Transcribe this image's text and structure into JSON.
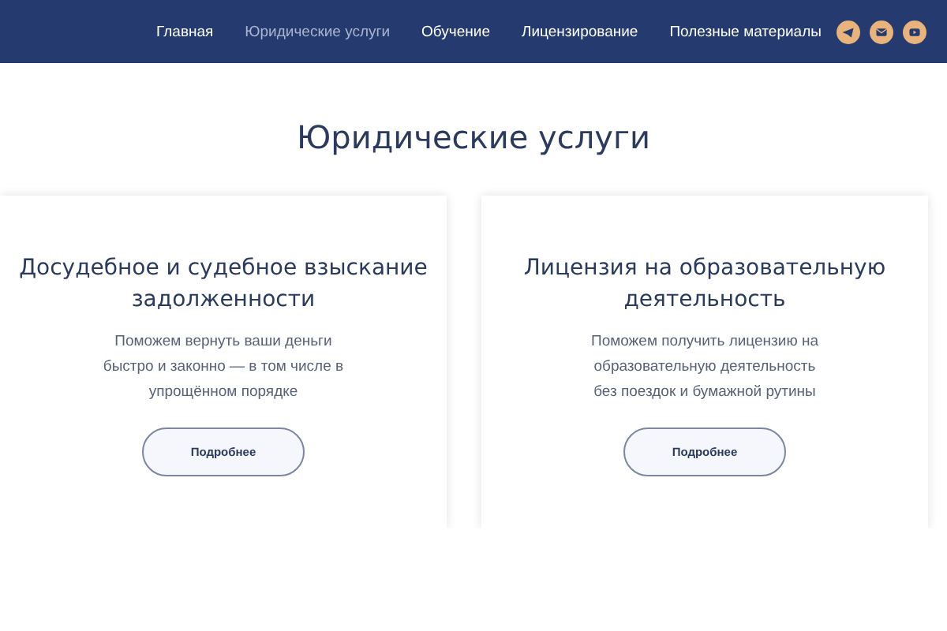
{
  "nav": [
    {
      "label": "Главная",
      "selected": false
    },
    {
      "label": "Юридические услуги",
      "selected": true
    },
    {
      "label": "Обучение",
      "selected": false
    },
    {
      "label": "Лицензирование",
      "selected": false
    },
    {
      "label": "Полезные материалы",
      "selected": false
    }
  ],
  "social": [
    {
      "kind": "telegram"
    },
    {
      "kind": "mail"
    },
    {
      "kind": "youtube"
    }
  ],
  "heading": "Юридические услуги",
  "cards": [
    {
      "title": "Досудебное и судебное взыскание задолженности",
      "description": "Поможем вернуть ваши деньги\nбыстро и законно — в том числе в\nупрощённом порядке",
      "button": "Подробнее"
    },
    {
      "title": "Лицензия на образовательную деятельность",
      "description": "Поможем получить лицензию на\nобразовательную деятельность\nбез поездок и бумажной рутины",
      "button": "Подробнее"
    }
  ]
}
